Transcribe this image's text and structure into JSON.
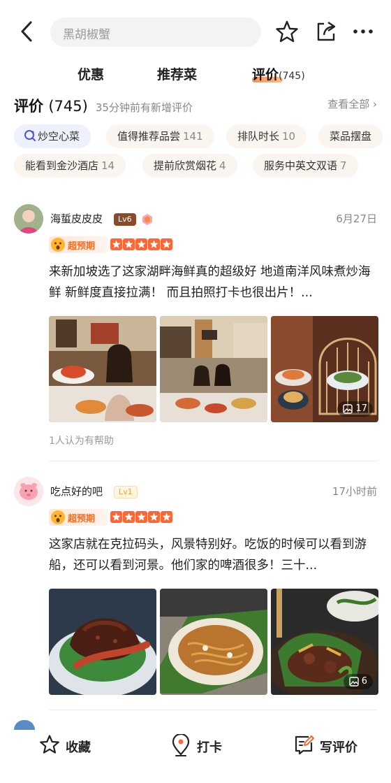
{
  "search": {
    "placeholder": "黑胡椒蟹"
  },
  "tabs": [
    {
      "label": "优惠"
    },
    {
      "label": "推荐菜"
    },
    {
      "label": "评价",
      "count": "(745)"
    }
  ],
  "review_header": {
    "title": "评价",
    "count": "(745)",
    "subtitle": "35分钟前有新增评价",
    "view_all": "查看全部"
  },
  "chips_row1": [
    {
      "label": "炒空心菜",
      "count": ""
    },
    {
      "label": "值得推荐品尝",
      "count": "141"
    },
    {
      "label": "排队时长",
      "count": "10"
    },
    {
      "label": "菜品摆盘",
      "count": ""
    }
  ],
  "chips_row2": [
    {
      "label": "能看到金沙酒店",
      "count": "14"
    },
    {
      "label": "提前欣赏烟花",
      "count": "4"
    },
    {
      "label": "服务中英文双语",
      "count": "7"
    }
  ],
  "reviews": [
    {
      "username": "海蜇皮皮皮",
      "level": "Lv6",
      "date": "6月27日",
      "badge": "超预期",
      "rating": 5,
      "content": "来新加坡选了这家湖畔海鲜真的超级好 地道南洋风味煮炒海鲜 新鲜度直接拉满！ 而且拍照打卡也很出片！...",
      "photo_count": "17",
      "helpful": "1人认为有帮助"
    },
    {
      "username": "吃点好的吧",
      "level": "Lv1",
      "date": "17小时前",
      "badge": "超预期",
      "rating": 5,
      "content": "这家店就在克拉码头，风景特别好。吃饭的时候可以看到游船，还可以看到河景。他们家的啤酒很多！三十...",
      "photo_count": "6"
    }
  ],
  "bottom_bar": {
    "favorite": "收藏",
    "checkin": "打卡",
    "write_review": "写评价"
  },
  "colors": {
    "accent": "#ff6633",
    "chip_bg": "#faf5ef"
  }
}
